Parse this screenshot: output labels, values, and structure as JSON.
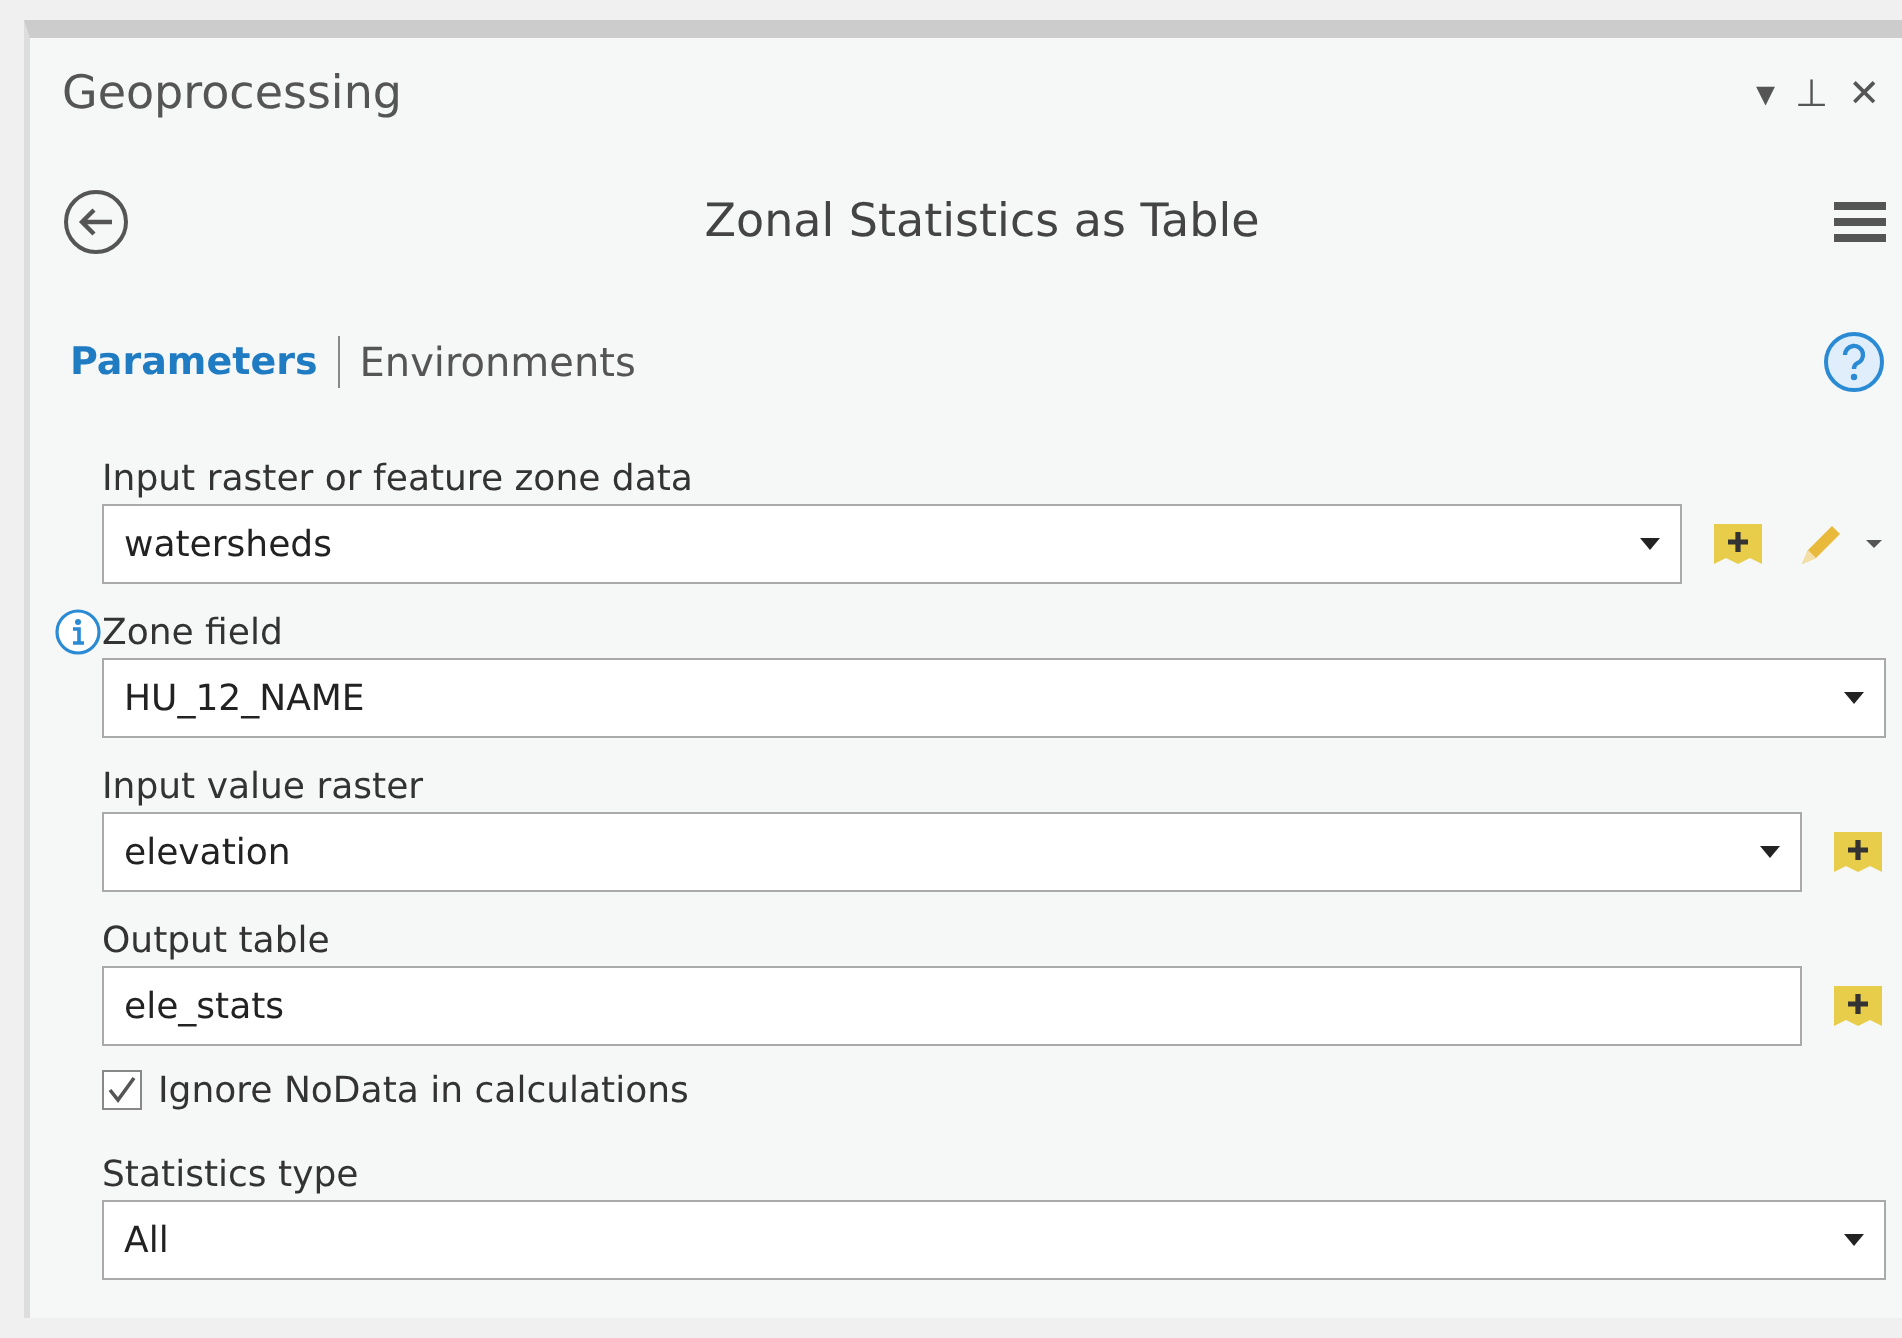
{
  "pane": {
    "title": "Geoprocessing",
    "controls": [
      "▾",
      "⊥",
      "✕"
    ]
  },
  "tool": {
    "title": "Zonal Statistics as Table"
  },
  "tabs": [
    {
      "label": "Parameters",
      "selected": true
    },
    {
      "label": "Environments",
      "selected": false
    }
  ],
  "parameters": [
    {
      "kind": "dropdown",
      "label": "Input raster or feature zone data",
      "value": "watersheds",
      "browse": true,
      "edit": true,
      "info": false
    },
    {
      "kind": "dropdown",
      "label": "Zone field",
      "value": "HU_12_NAME",
      "browse": false,
      "edit": false,
      "info": true
    },
    {
      "kind": "dropdown",
      "label": "Input value raster",
      "value": "elevation",
      "browse": true,
      "edit": false,
      "info": false
    },
    {
      "kind": "text",
      "label": "Output table",
      "value": "ele_stats",
      "browse": true,
      "edit": false,
      "info": false
    },
    {
      "kind": "checkbox",
      "label": "Ignore NoData in calculations",
      "checked": true
    },
    {
      "kind": "dropdown",
      "label": "Statistics type",
      "value": "All",
      "browse": false,
      "edit": false,
      "info": false
    }
  ]
}
